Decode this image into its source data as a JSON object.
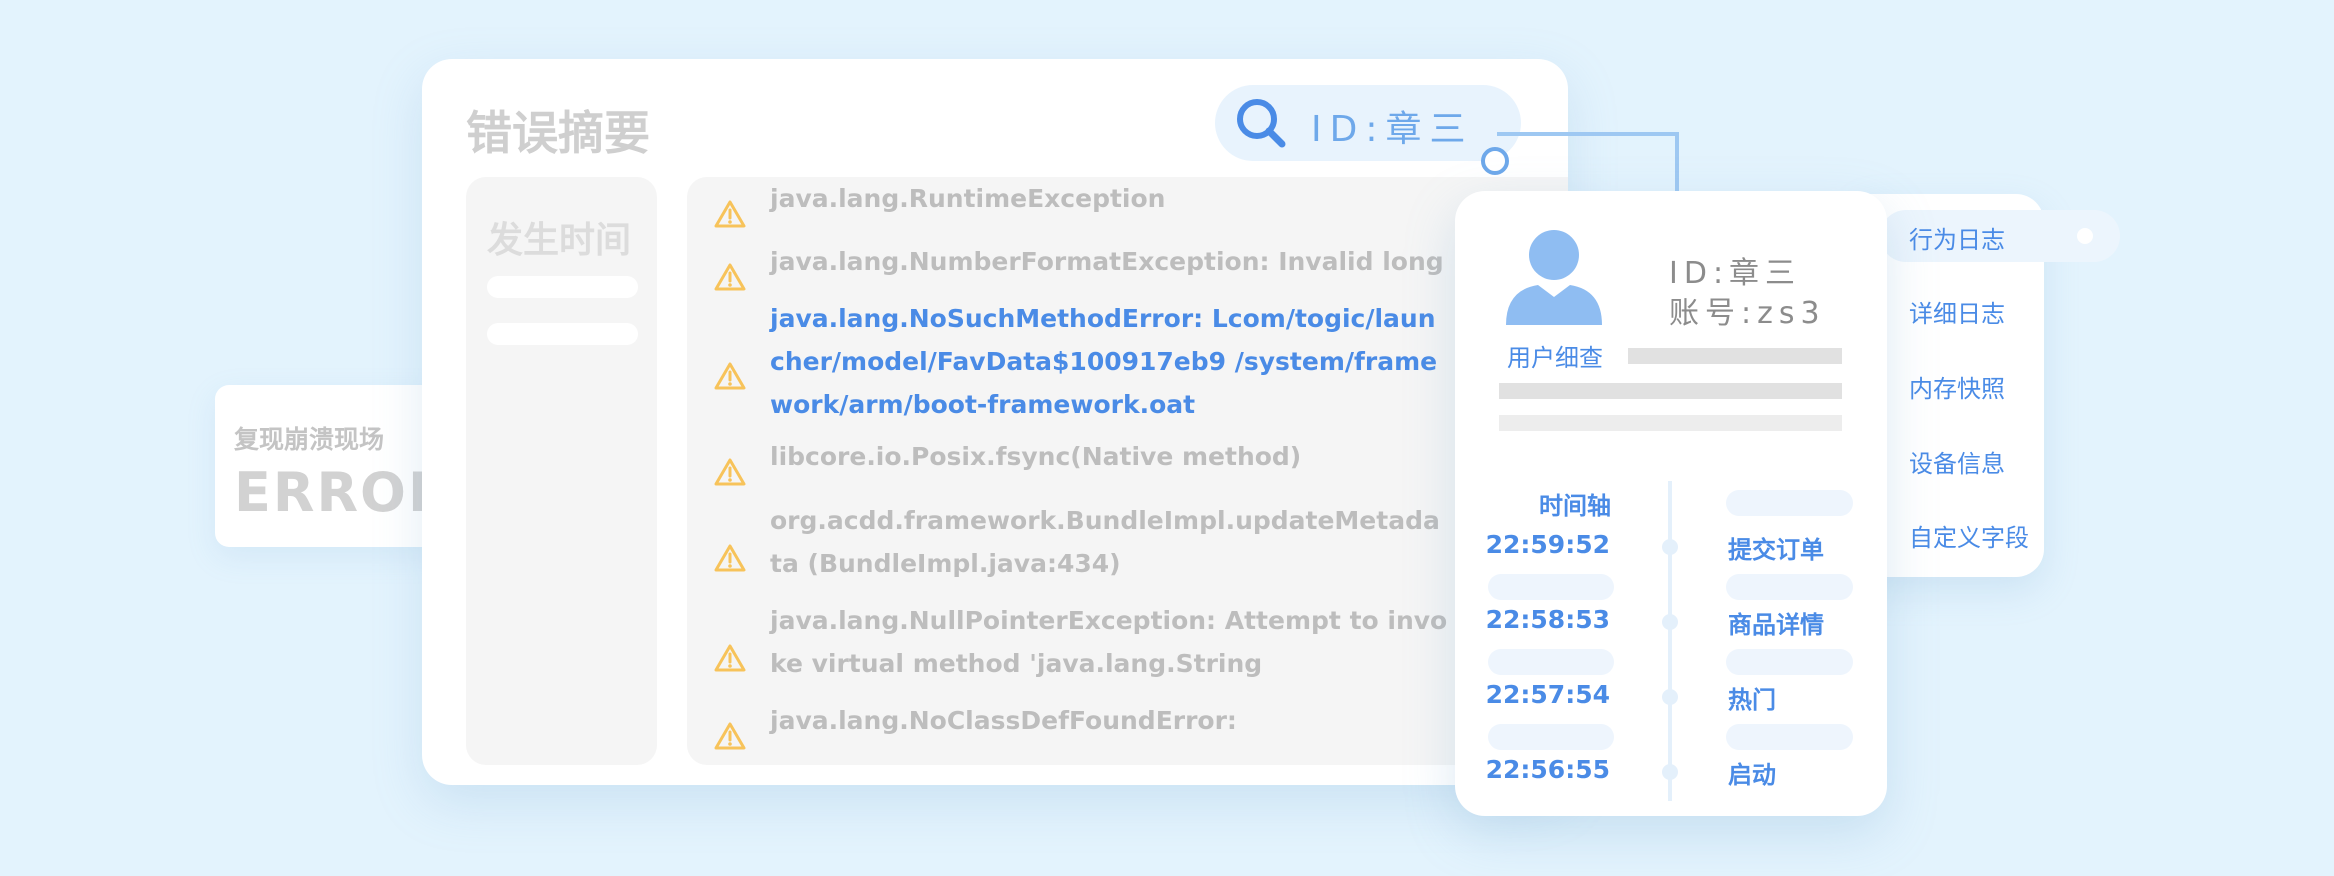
{
  "error_card": {
    "label": "复现崩溃现场",
    "title": "ERROR"
  },
  "summary": {
    "title": "错误摘要",
    "search": {
      "text": "ID:章三",
      "icon": "search-icon"
    },
    "time_column": {
      "title": "发生时间"
    },
    "logs": [
      {
        "text": "java.lang.RuntimeException",
        "active": false
      },
      {
        "text": "java.lang.NumberFormatException: Invalid long",
        "active": false
      },
      {
        "text": "java.lang.NoSuchMethodError: Lcom/togic/launcher/model/FavData$100917eb9 /system/framework/arm/boot-framework.oat",
        "active": true
      },
      {
        "text": "libcore.io.Posix.fsync(Native method)",
        "active": false
      },
      {
        "text": "org.acdd.framework.BundleImpl.updateMetadata (BundleImpl.java:434)",
        "active": false
      },
      {
        "text": "java.lang.NullPointerException: Attempt to invoke virtual method 'java.lang.String",
        "active": false
      },
      {
        "text": "java.lang.NoClassDefFoundError:",
        "active": false
      }
    ]
  },
  "user": {
    "avatar_label": "用户细查",
    "id_line": "ID:章三",
    "account_line": "账号:zs3",
    "timeline": {
      "title": "时间轴",
      "entries": [
        {
          "time": "22:59:52",
          "event": "提交订单"
        },
        {
          "time": "22:58:53",
          "event": "商品详情"
        },
        {
          "time": "22:57:54",
          "event": "热门"
        },
        {
          "time": "22:56:55",
          "event": "启动"
        }
      ]
    }
  },
  "menu": {
    "items": [
      "行为日志",
      "详细日志",
      "内存快照",
      "设备信息",
      "自定义字段"
    ],
    "selected": 0
  },
  "colors": {
    "accent": "#4a8be6",
    "background": "#e3f3fd",
    "warning": "#f7c35a",
    "muted_text": "#bdbdbd"
  }
}
